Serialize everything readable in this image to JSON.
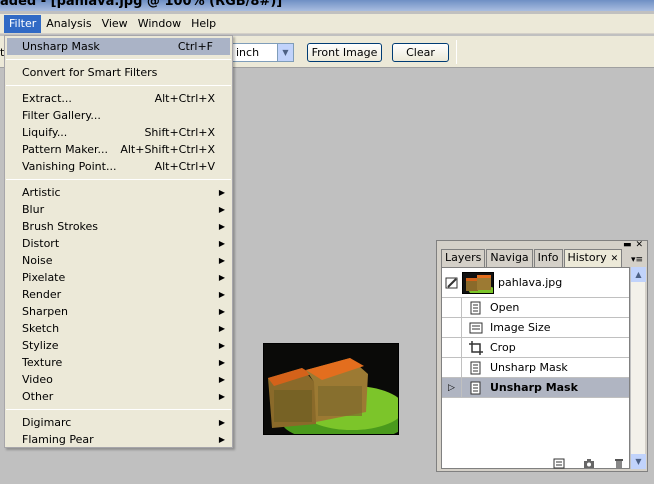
{
  "window": {
    "title": "aded - [pahlava.jpg @ 100% (RGB/8#)]"
  },
  "menubar": {
    "items": [
      "Filter",
      "Analysis",
      "View",
      "Window",
      "Help"
    ],
    "active": "Filter"
  },
  "options": {
    "cut_label": "ti",
    "unit_value": "inch",
    "front_image_label": "Front Image",
    "clear_label": "Clear"
  },
  "filter_menu": {
    "last_filter": {
      "label": "Unsharp Mask",
      "shortcut": "Ctrl+F"
    },
    "convert": "Convert for Smart Filters",
    "tools": [
      {
        "label": "Extract...",
        "shortcut": "Alt+Ctrl+X"
      },
      {
        "label": "Filter Gallery...",
        "shortcut": ""
      },
      {
        "label": "Liquify...",
        "shortcut": "Shift+Ctrl+X"
      },
      {
        "label": "Pattern Maker...",
        "shortcut": "Alt+Shift+Ctrl+X"
      },
      {
        "label": "Vanishing Point...",
        "shortcut": "Alt+Ctrl+V"
      }
    ],
    "groups": [
      "Artistic",
      "Blur",
      "Brush Strokes",
      "Distort",
      "Noise",
      "Pixelate",
      "Render",
      "Sharpen",
      "Sketch",
      "Stylize",
      "Texture",
      "Video",
      "Other"
    ],
    "plugins": [
      "Digimarc",
      "Flaming Pear"
    ]
  },
  "panel": {
    "tabs": [
      "Layers",
      "Naviga",
      "Info",
      "History"
    ],
    "active_tab": "History",
    "snapshot_name": "pahlava.jpg",
    "history": [
      "Open",
      "Image Size",
      "Crop",
      "Unsharp Mask",
      "Unsharp Mask"
    ],
    "selected_index": 4
  }
}
